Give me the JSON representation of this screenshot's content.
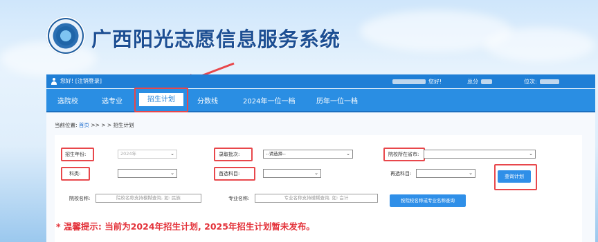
{
  "header": {
    "title": "广西阳光志愿信息服务系统",
    "logo_icon": "emblem-logo-icon"
  },
  "userbar": {
    "greeting": "您好! [注销登录]",
    "score_label": "总分",
    "rank_label": "位次:",
    "note_label": "您好!"
  },
  "nav": {
    "items": [
      "选院校",
      "选专业",
      "招生计划",
      "分数线",
      "2024年一位一档",
      "历年一位一档"
    ],
    "active": "招生计划"
  },
  "breadcrumb": {
    "prefix": "当前位置:",
    "home": "首页",
    "sep": ">> > >",
    "current": "招生计划"
  },
  "form": {
    "year_label": "招生年份:",
    "year_value": "2024年",
    "batch_label": "录取批次:",
    "batch_value": "--请选择--",
    "province_label": "院校所在省市:",
    "category_label": "科类:",
    "first_subject_label": "首选科目:",
    "second_subject_label": "再选科目:",
    "school_label": "院校名称:",
    "school_placeholder": "院校名称支持模糊查询, 如: 民族",
    "major_label": "专业名称:",
    "major_placeholder": "专业名称支持模糊查询, 如: 会计",
    "query_button": "查询计划",
    "order_button": "按院校名称或专业名称查询"
  },
  "notice": "* 温馨提示: 当前为2024年招生计划, 2025年招生计划暂未发布。",
  "colors": {
    "nav": "#2a8ee3",
    "userbar": "#1f7fd6",
    "highlight": "#e8474b",
    "notice": "#e3323a",
    "title": "#1d4f93"
  }
}
